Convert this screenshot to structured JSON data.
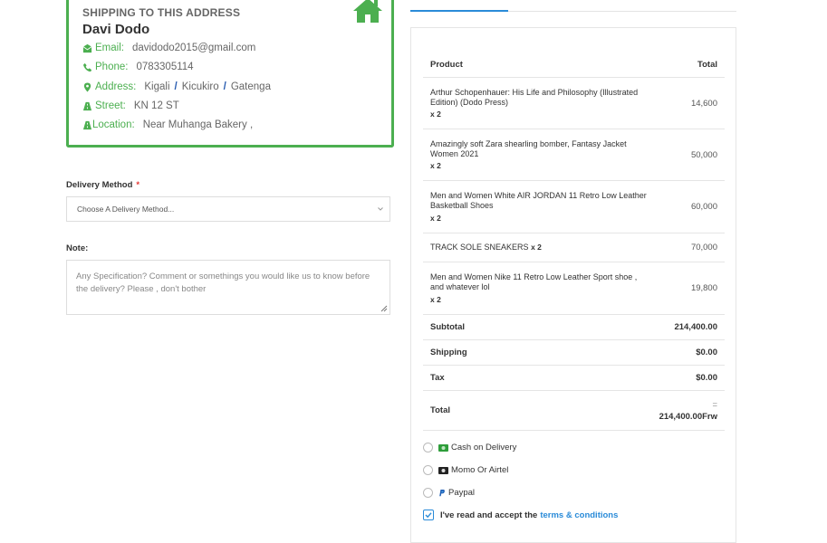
{
  "shipping": {
    "heading": "SHIPPING TO THIS ADDRESS",
    "name": "Davi Dodo",
    "email_label": "Email:",
    "email": "davidodo2015@gmail.com",
    "phone_label": "Phone:",
    "phone": "0783305114",
    "address_label": "Address:",
    "address_parts": [
      "Kigali",
      "Kicukiro",
      "Gatenga"
    ],
    "address_separator": "/",
    "street_label": "Street:",
    "street": "KN 12 ST",
    "location_label": "Location:",
    "location": "Near Muhanga Bakery ,",
    "accent_color": "#4caf50"
  },
  "delivery": {
    "label": "Delivery Method",
    "required_mark": "*",
    "selected": "Choose A Delivery Method..."
  },
  "note": {
    "label": "Note:",
    "placeholder": "Any Specification? Comment or somethings you would like us to know before the delivery? Please , don't bother"
  },
  "order": {
    "col_product": "Product",
    "col_total": "Total",
    "items": [
      {
        "name": "Arthur Schopenhauer: His Life and Philosophy (Illustrated Edition) (Dodo Press)",
        "qty": "x 2",
        "total": "14,600"
      },
      {
        "name": "Amazingly soft Zara shearling bomber, Fantasy Jacket Women 2021",
        "qty": "x 2",
        "total": "50,000"
      },
      {
        "name": "Men and Women White AIR JORDAN 11 Retro Low Leather Basketball Shoes",
        "qty": "x 2",
        "total": "60,000"
      },
      {
        "name": "TRACK SOLE SNEAKERS",
        "qty": "x 2",
        "total": "70,000"
      },
      {
        "name": "Men and Women Nike 11 Retro Low Leather Sport shoe , and whatever lol",
        "qty": "x 2",
        "total": "19,800"
      }
    ],
    "subtotal_label": "Subtotal",
    "subtotal": "214,400.00",
    "shipping_label": "Shipping",
    "shipping": "$0.00",
    "tax_label": "Tax",
    "tax": "$0.00",
    "total_label": "Total",
    "total_eq": "=",
    "total": "214,400.00Frw"
  },
  "payment": {
    "options": [
      {
        "label": "Cash on Delivery",
        "icon": "cash-icon"
      },
      {
        "label": "Momo Or Airtel",
        "icon": "momo-icon"
      },
      {
        "label": "Paypal",
        "icon": "paypal-icon"
      }
    ],
    "terms_prefix": "I've read and accept the",
    "terms_link": "terms & conditions",
    "link_color": "#2a8bd8"
  }
}
